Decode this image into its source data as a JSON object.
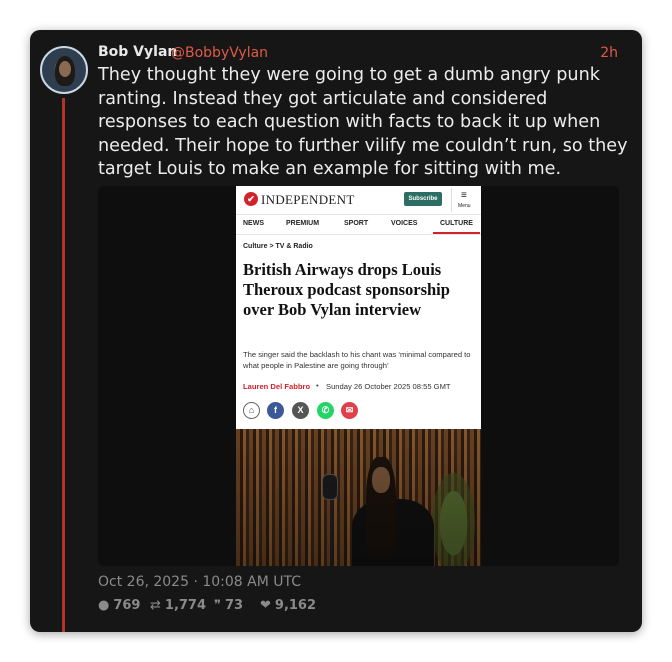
{
  "tweet": {
    "author_name": "Bob Vylan",
    "handle": "@BobbyVylan",
    "relative_time": "2h",
    "text": "They thought they were going to get a dumb angry punk ranting. Instead they got articulate and considered responses to each question with facts to back it up when needed. Their hope to further vilify me couldn’t run, so they target Louis to make an example for sitting with me.",
    "timestamp": "Oct 26, 2025 · 10:08 AM UTC",
    "stats": {
      "replies": "769",
      "reposts": "1,774",
      "quotes": "73",
      "likes": "9,162"
    }
  },
  "article": {
    "logo_mark": "✔",
    "logo_text": "INDEPENDENT",
    "subscribe_label": "Subscribe",
    "menu_icon": "≡",
    "menu_label": "Menu",
    "nav": [
      "NEWS",
      "PREMIUM",
      "SPORT",
      "VOICES",
      "CULTURE"
    ],
    "active_nav": "CULTURE",
    "breadcrumb": "Culture > TV & Radio",
    "headline": "British Airways drops Louis Theroux podcast sponsorship over Bob Vylan interview",
    "standfirst": "The singer said the backlash to his chant was ‘minimal compared to what people in Palestine are going through’",
    "author": "Lauren Del Fabbro",
    "date": "Sunday 26 October 2025 08:55 GMT",
    "share_icons": [
      "bookmark-icon",
      "facebook-icon",
      "x-icon",
      "whatsapp-icon",
      "email-icon"
    ]
  },
  "icons": {
    "reply": "💬",
    "repost": "⇄",
    "quote": "❞",
    "like": "❤"
  },
  "colors": {
    "card_bg": "#161616",
    "accent": "#e05a4a",
    "thread_line": "#b5322a",
    "independent_red": "#d2232a",
    "subscribe_green": "#2c6e63"
  }
}
